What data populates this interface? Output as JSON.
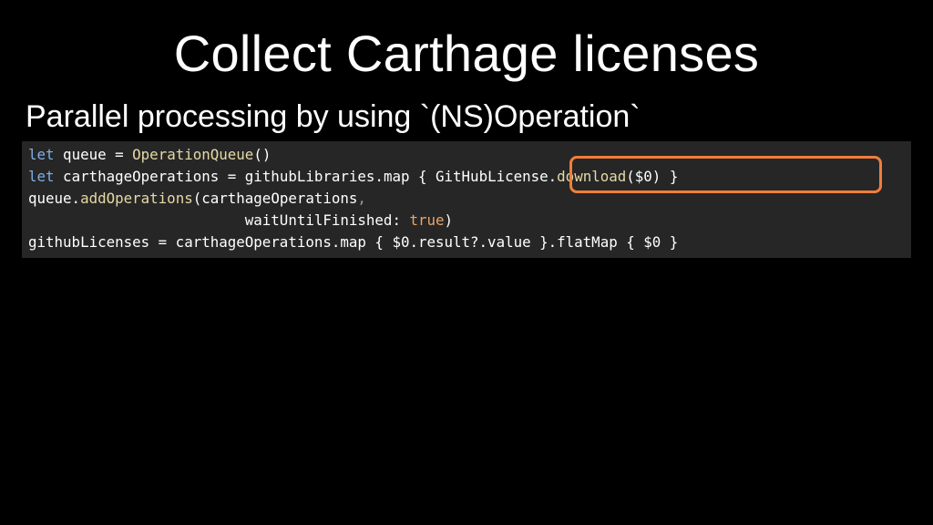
{
  "slide": {
    "title": "Collect Carthage licenses",
    "subtitle": "Parallel processing by using `(NS)Operation`"
  },
  "code": {
    "line1": {
      "kw": "let",
      "text": " queue = ",
      "type": "OperationQueue",
      "end": "()"
    },
    "line2": {
      "kw": "let",
      "text": " carthageOperations = githubLibraries.map { ",
      "highlight_obj": "GitHubLicense.",
      "highlight_fn": "download",
      "highlight_end": "($0)",
      "end": " }"
    },
    "line3": {
      "obj": "queue.",
      "fn": "addOperations",
      "args": "(carthageOperations",
      "comma": ","
    },
    "line4": {
      "indent": "                         ",
      "label": "waitUntilFinished: ",
      "bool": "true",
      "end": ")"
    },
    "line5": {
      "text": "githubLicenses = carthageOperations.map { $0.result?.value }.flatMap { $0 }"
    }
  },
  "colors": {
    "keyword": "#7fb0e6",
    "type": "#e6d9a6",
    "bool": "#e8a56b",
    "highlight_border": "#f07e3a",
    "code_background": "#262626"
  }
}
